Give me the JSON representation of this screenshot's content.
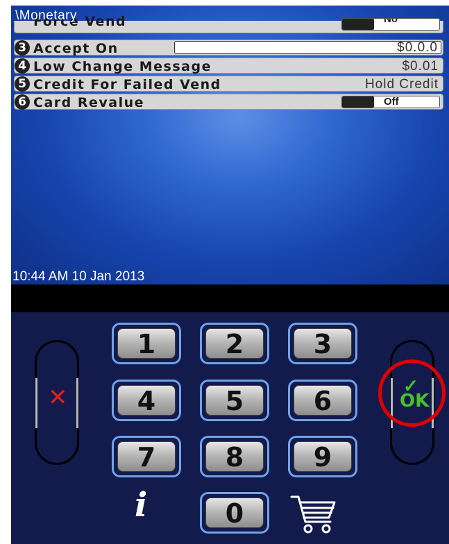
{
  "screen": {
    "breadcrumb": "\\Monetary",
    "partial_row": {
      "label": "Force Vend",
      "value": "No"
    },
    "rows": [
      {
        "num": "3",
        "label": "Accept On",
        "value": "$0.0.0"
      },
      {
        "num": "4",
        "label": "Low Change Message",
        "value": "$0.01"
      },
      {
        "num": "5",
        "label": "Credit For Failed Vend",
        "value": "Hold Credit"
      },
      {
        "num": "6",
        "label": "Card Revalue",
        "value": "Off"
      }
    ],
    "clock": "10:44 AM 10 Jan 2013"
  },
  "keypad": {
    "keys": [
      "1",
      "2",
      "3",
      "4",
      "5",
      "6",
      "7",
      "8",
      "9",
      "0"
    ],
    "cancel_label": "X",
    "ok_label": "OK",
    "info_label": "i"
  },
  "colors": {
    "accent_ok": "#4ac12b",
    "cancel": "#e21d1d",
    "highlight_ring": "#e00000",
    "pad_bg": "#131a4c"
  },
  "icons": {
    "cancel": "x-icon",
    "ok": "checkmark-icon",
    "info": "info-icon",
    "cart": "shopping-cart-icon"
  }
}
